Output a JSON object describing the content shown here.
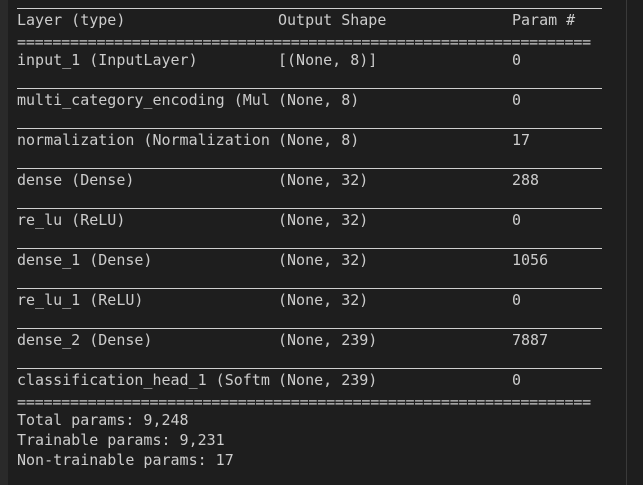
{
  "header": {
    "col_layer": "Layer (type)",
    "col_output": "Output Shape",
    "col_params": "Param #"
  },
  "rows": [
    {
      "layer": "input_1 (InputLayer)",
      "output": "[(None, 8)]",
      "params": "0"
    },
    {
      "layer": "multi_category_encoding (Mul",
      "output": "(None, 8)",
      "params": "0"
    },
    {
      "layer": "normalization (Normalization",
      "output": "(None, 8)",
      "params": "17"
    },
    {
      "layer": "dense (Dense)",
      "output": "(None, 32)",
      "params": "288"
    },
    {
      "layer": "re_lu (ReLU)",
      "output": "(None, 32)",
      "params": "0"
    },
    {
      "layer": "dense_1 (Dense)",
      "output": "(None, 32)",
      "params": "1056"
    },
    {
      "layer": "re_lu_1 (ReLU)",
      "output": "(None, 32)",
      "params": "0"
    },
    {
      "layer": "dense_2 (Dense)",
      "output": "(None, 239)",
      "params": "7887"
    },
    {
      "layer": "classification_head_1 (Softm",
      "output": "(None, 239)",
      "params": "0"
    }
  ],
  "summary": {
    "total": "Total params: 9,248",
    "trainable": "Trainable params: 9,231",
    "non_trainable": "Non-trainable params: 17"
  }
}
